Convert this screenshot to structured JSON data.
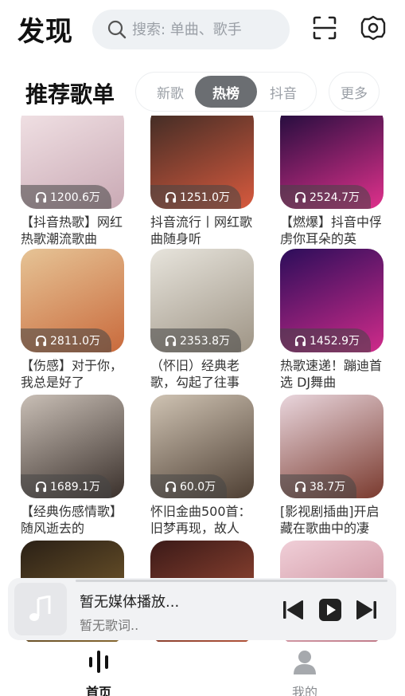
{
  "header": {
    "title": "发现",
    "search_placeholder": "搜索: 单曲、歌手"
  },
  "section": {
    "title": "推荐歌单",
    "tabs": [
      "新歌",
      "热榜",
      "抖音"
    ],
    "active_tab": "热榜",
    "more_label": "更多"
  },
  "playlists": [
    {
      "count": "1200.6万",
      "title": "【抖音热歌】网红热歌潮流歌曲",
      "colors": [
        "#f2e3e6",
        "#c9a9b4"
      ]
    },
    {
      "count": "1251.0万",
      "title": "抖音流行丨网红歌曲随身听",
      "colors": [
        "#3a2a24",
        "#d85a3e"
      ]
    },
    {
      "count": "2524.7万",
      "title": "【燃爆】抖音中俘虏你耳朵的英",
      "colors": [
        "#1a0b3a",
        "#e0318c"
      ]
    },
    {
      "count": "2811.0万",
      "title": "【伤感】对于你，我总是好了",
      "colors": [
        "#e6c496",
        "#c96a3c"
      ]
    },
    {
      "count": "2353.8万",
      "title": "（怀旧）经典老歌，勾起了往事",
      "colors": [
        "#e7e4dc",
        "#9e9485"
      ]
    },
    {
      "count": "1452.9万",
      "title": "热歌速递！蹦迪首选 DJ舞曲",
      "colors": [
        "#2b0d5a",
        "#d02b8a"
      ]
    },
    {
      "count": "1689.1万",
      "title": "【经典伤感情歌】随风逝去的",
      "colors": [
        "#c9bfb6",
        "#3a302b"
      ]
    },
    {
      "count": "60.0万",
      "title": "怀旧金曲500首：旧梦再现，故人",
      "colors": [
        "#cfc3b3",
        "#4e3f33"
      ]
    },
    {
      "count": "38.7万",
      "title": "[影视剧插曲]开启藏在歌曲中的凄",
      "colors": [
        "#e9d6dd",
        "#7a3a2e"
      ]
    },
    {
      "count": "",
      "title": "",
      "colors": [
        "#2a2016",
        "#8a6a32"
      ]
    },
    {
      "count": "",
      "title": "",
      "colors": [
        "#3b1a18",
        "#b5563c"
      ]
    },
    {
      "count": "",
      "title": "",
      "colors": [
        "#f0cfd8",
        "#c07a88"
      ]
    }
  ],
  "player": {
    "title": "暂无媒体播放...",
    "lyric": "暂无歌词.."
  },
  "nav": {
    "home": "首页",
    "mine": "我的"
  }
}
